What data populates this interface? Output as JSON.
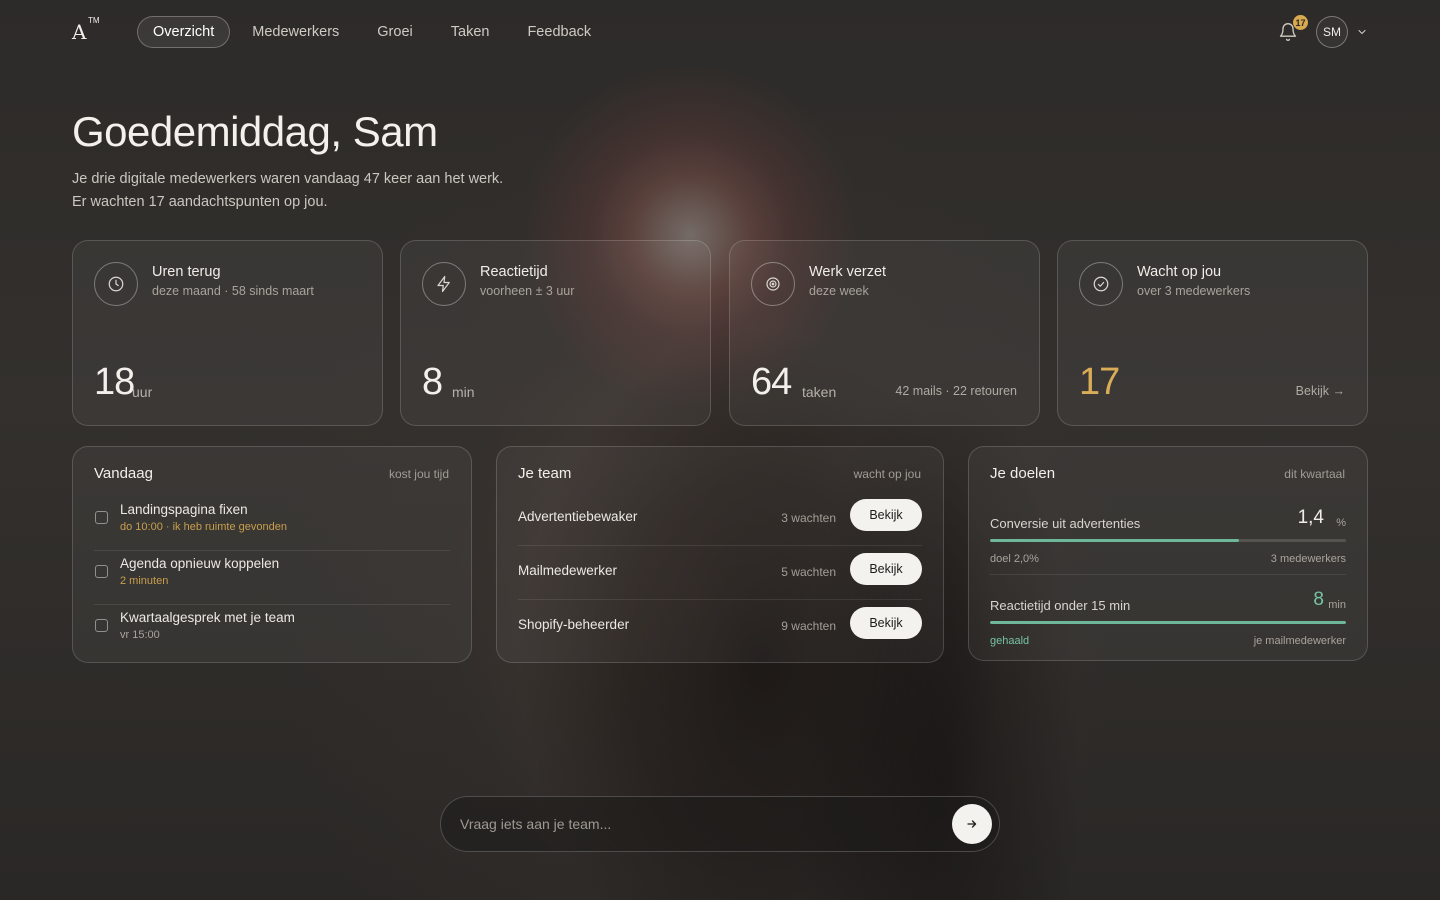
{
  "nav": {
    "logo": "A",
    "logo_mark": "TM",
    "tabs": [
      {
        "label": "Overzicht",
        "active": true
      },
      {
        "label": "Medewerkers",
        "active": false
      },
      {
        "label": "Groei",
        "active": false
      },
      {
        "label": "Taken",
        "active": false
      },
      {
        "label": "Feedback",
        "active": false
      }
    ],
    "notifications": "17",
    "avatar": "SM"
  },
  "hero": {
    "greeting": "Goedemiddag, Sam",
    "line1": "Je drie digitale medewerkers waren vandaag 47 keer aan het werk.",
    "line2": "Er wachten 17 aandachtspunten op jou."
  },
  "stats": [
    {
      "icon": "clock-icon",
      "title": "Uren terug",
      "subtitle": "deze maand · 58 sinds maart",
      "value": "18",
      "unit": "uur",
      "right": ""
    },
    {
      "icon": "lightning-icon",
      "title": "Reactietijd",
      "subtitle": "voorheen ± 3 uur",
      "value": "8",
      "unit": "min",
      "right": ""
    },
    {
      "icon": "target-icon",
      "title": "Werk verzet",
      "subtitle": "deze week",
      "value": "64",
      "unit": "taken",
      "right": "42 mails · 22 retouren"
    },
    {
      "icon": "check-circle-icon",
      "title": "Wacht op jou",
      "subtitle": "over 3 medewerkers",
      "value": "17",
      "unit": "",
      "right": "Bekijk →"
    }
  ],
  "today": {
    "title": "Vandaag",
    "meta": "kost jou tijd",
    "items": [
      {
        "title": "Landingspagina fixen",
        "sub": "do 10:00 · ik heb ruimte gevonden"
      },
      {
        "title": "Agenda opnieuw koppelen",
        "sub": "2 minuten"
      },
      {
        "title": "Kwartaalgesprek met je team",
        "sub": "vr 15:00"
      }
    ]
  },
  "team": {
    "title": "Je team",
    "meta": "wacht op jou",
    "members": [
      {
        "name": "Advertentiebewaker",
        "waiting": "3 wachten",
        "button": "Bekijk"
      },
      {
        "name": "Mailmedewerker",
        "waiting": "5 wachten",
        "button": "Bekijk"
      },
      {
        "name": "Shopify-beheerder",
        "waiting": "9 wachten",
        "button": "Bekijk"
      }
    ]
  },
  "goals": {
    "title": "Je doelen",
    "meta": "dit kwartaal",
    "items": [
      {
        "title": "Conversie uit advertenties",
        "value": "1,4",
        "unit": "%",
        "progress": 0.7,
        "left": "doel 2,0%",
        "right": "3 medewerkers"
      },
      {
        "title": "Reactietijd onder 15 min",
        "value": "8",
        "unit": "min",
        "progress": 1.0,
        "left": "gehaald",
        "right": "je mailmedewerker"
      }
    ]
  },
  "ask": {
    "placeholder": "Vraag iets aan je team..."
  },
  "colors": {
    "accent_gold": "#d9ad58",
    "accent_green": "#6fb79a",
    "button_bg": "#f4f2ee"
  }
}
